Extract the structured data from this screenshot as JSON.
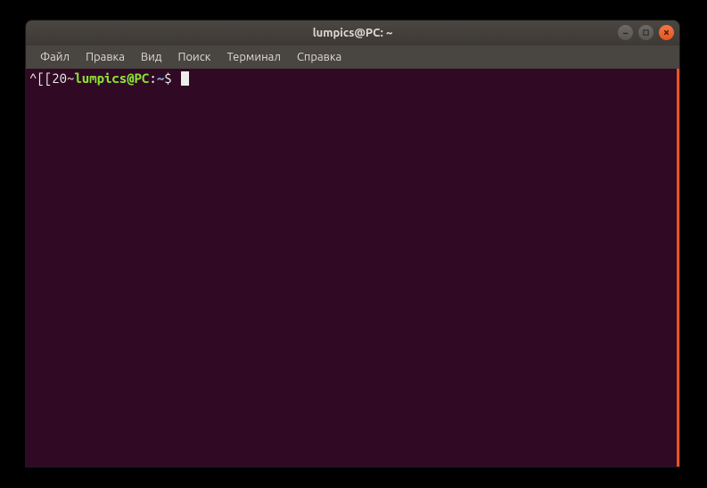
{
  "window": {
    "title": "lumpics@PC: ~"
  },
  "menubar": {
    "items": [
      "Файл",
      "Правка",
      "Вид",
      "Поиск",
      "Терминал",
      "Справка"
    ]
  },
  "terminal": {
    "escape_sequence": "^[[20~",
    "user_host": "lumpics@PC",
    "colon": ":",
    "path": "~",
    "prompt_symbol": "$ "
  },
  "colors": {
    "terminal_bg": "#300a24",
    "titlebar_bg": "#3d3934",
    "close_btn": "#e95420",
    "user_host_color": "#8ae234",
    "path_color": "#729fcf"
  }
}
